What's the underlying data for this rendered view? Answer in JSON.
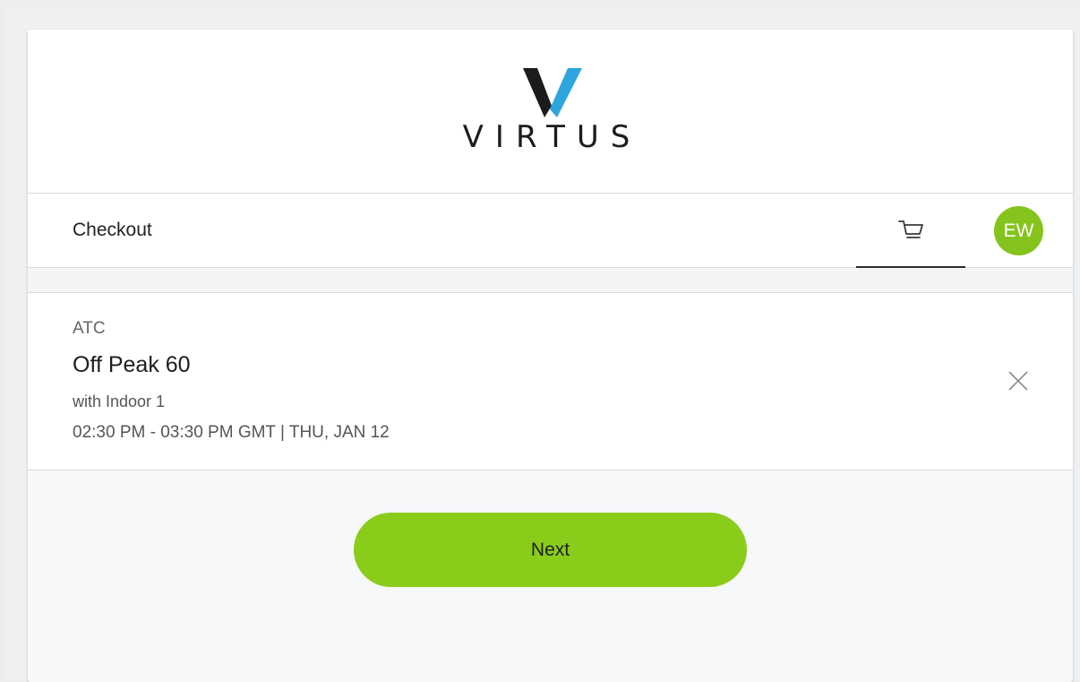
{
  "brand": {
    "logo_text": "VIRTUS"
  },
  "nav": {
    "title": "Checkout",
    "cart_icon": "cart-icon",
    "avatar_initials": "EW",
    "avatar_color": "#84c41c"
  },
  "cart_item": {
    "venue": "ATC",
    "name": "Off Peak 60",
    "with": "with Indoor 1",
    "time": "02:30 PM - 03:30 PM GMT | THU, JAN 12",
    "remove_icon": "close-icon"
  },
  "footer": {
    "next_label": "Next",
    "next_color": "#8acc1a"
  }
}
